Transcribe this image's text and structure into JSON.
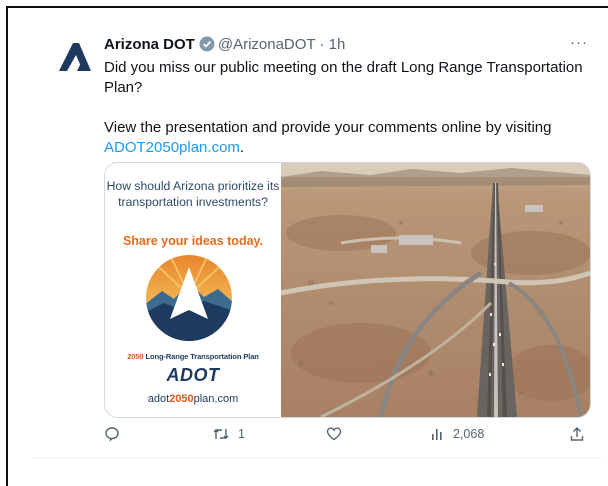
{
  "author": {
    "name": "Arizona DOT",
    "handle": "@ArizonaDOT",
    "separator": "·",
    "time": "1h",
    "more": "···"
  },
  "tweet": {
    "line1": "Did you miss our public meeting on the draft Long Range Transportation Plan?",
    "line2_text": "View the presentation and provide your comments online by visiting ",
    "line2_link": "ADOT2050plan.com",
    "line2_end": "."
  },
  "promo": {
    "question": "How should Arizona prioritize its transportation investments?",
    "cta": "Share your ideas today.",
    "plan_year": "2050",
    "plan_name": " Long-Range Transportation Plan",
    "logo_text": "ADOT",
    "url_pre": "adot",
    "url_year": "2050",
    "url_post": "plan.com"
  },
  "actions": {
    "retweets": "1",
    "views": "2,068"
  },
  "colors": {
    "link": "#1d9bf0",
    "orange": "#e96a1a",
    "navy": "#1e3a5f",
    "muted": "#536471"
  }
}
